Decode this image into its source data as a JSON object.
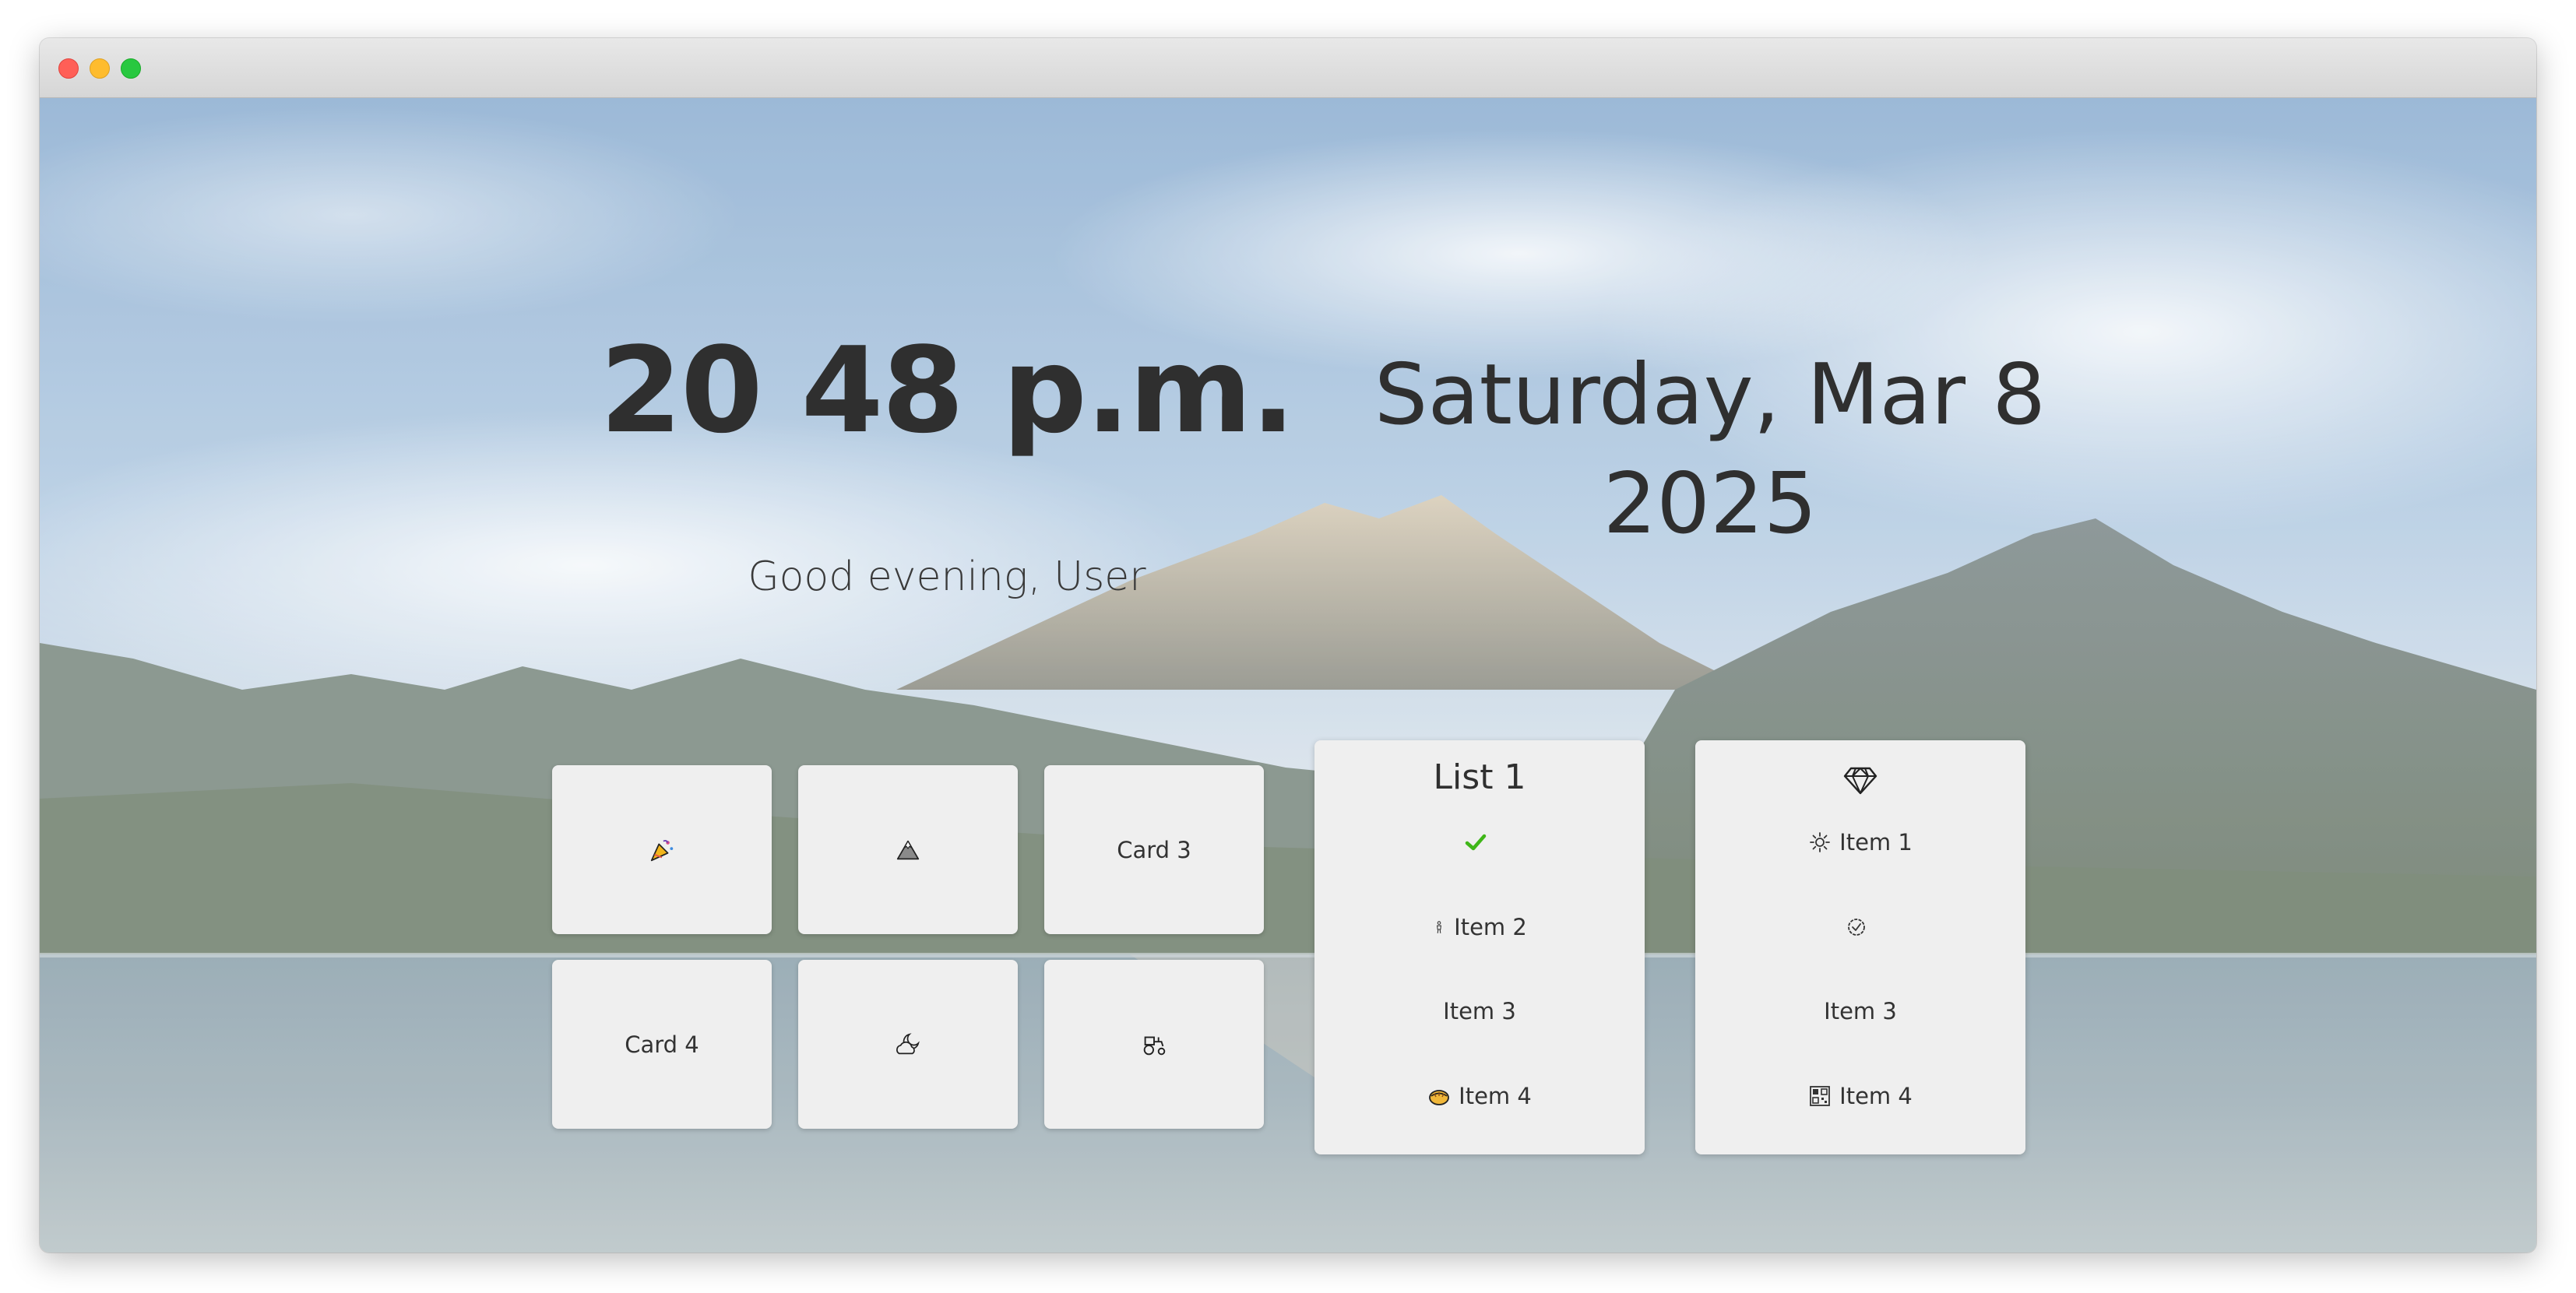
{
  "window": {
    "controls": [
      "close",
      "minimize",
      "maximize"
    ]
  },
  "clock": {
    "time": "20 48 p.m.",
    "greeting": "Good evening, User"
  },
  "date": {
    "line1": "Saturday, Mar 8",
    "line2": "2025"
  },
  "cards": [
    {
      "label": "",
      "icon": "party-popper-icon"
    },
    {
      "label": "",
      "icon": "mountain-icon"
    },
    {
      "label": "Card 3",
      "icon": ""
    },
    {
      "label": "Card 4",
      "icon": ""
    },
    {
      "label": "",
      "icon": "moon-cloud-icon"
    },
    {
      "label": "",
      "icon": "tractor-icon"
    }
  ],
  "list1": {
    "title": "List 1",
    "items": [
      {
        "label": "",
        "icon": "checkmark-icon"
      },
      {
        "label": "Item 2",
        "icon": "person-icon"
      },
      {
        "label": "Item 3",
        "icon": ""
      },
      {
        "label": "Item 4",
        "icon": "pie-icon"
      }
    ]
  },
  "list2": {
    "header_icon": "gem-icon",
    "items": [
      {
        "label": "Item 1",
        "icon": "sun-icon"
      },
      {
        "label": "",
        "icon": "check-circle-icon"
      },
      {
        "label": "Item 3",
        "icon": ""
      },
      {
        "label": "Item 4",
        "icon": "qr-code-icon"
      }
    ]
  },
  "colors": {
    "card_bg": "#efefef",
    "text": "#2f2f2f",
    "check_green": "#3fb618"
  }
}
